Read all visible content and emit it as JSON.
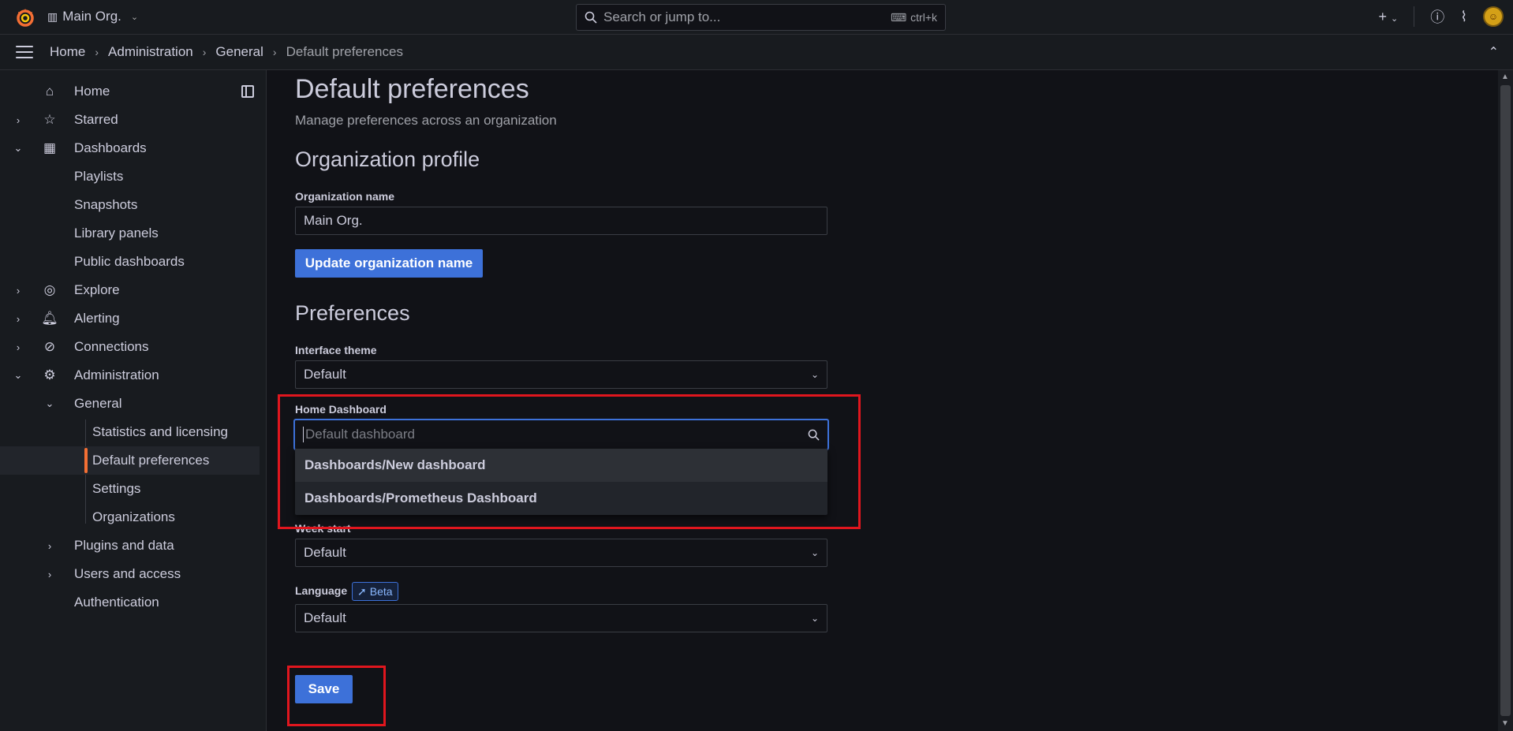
{
  "topbar": {
    "org_name": "Main Org.",
    "search_placeholder": "Search or jump to...",
    "search_shortcut": "ctrl+k"
  },
  "breadcrumbs": [
    "Home",
    "Administration",
    "General",
    "Default preferences"
  ],
  "sidebar": {
    "items": [
      {
        "label": "Home"
      },
      {
        "label": "Starred"
      },
      {
        "label": "Dashboards"
      },
      {
        "label": "Playlists"
      },
      {
        "label": "Snapshots"
      },
      {
        "label": "Library panels"
      },
      {
        "label": "Public dashboards"
      },
      {
        "label": "Explore"
      },
      {
        "label": "Alerting"
      },
      {
        "label": "Connections"
      },
      {
        "label": "Administration"
      },
      {
        "label": "General"
      },
      {
        "label": "Statistics and licensing"
      },
      {
        "label": "Default preferences"
      },
      {
        "label": "Settings"
      },
      {
        "label": "Organizations"
      },
      {
        "label": "Plugins and data"
      },
      {
        "label": "Users and access"
      },
      {
        "label": "Authentication"
      }
    ]
  },
  "page": {
    "title": "Default preferences",
    "subtitle": "Manage preferences across an organization"
  },
  "org_profile": {
    "heading": "Organization profile",
    "name_label": "Organization name",
    "name_value": "Main Org.",
    "update_button": "Update organization name"
  },
  "preferences": {
    "heading": "Preferences",
    "theme_label": "Interface theme",
    "theme_value": "Default",
    "home_dashboard_label": "Home Dashboard",
    "home_dashboard_placeholder": "Default dashboard",
    "home_dashboard_options": [
      "Dashboards/New dashboard",
      "Dashboards/Prometheus Dashboard"
    ],
    "week_start_label": "Week start",
    "week_start_value": "Default",
    "language_label": "Language",
    "language_badge": "Beta",
    "language_value": "Default",
    "save_button": "Save"
  },
  "colors": {
    "primary": "#3d71d9",
    "accent_active": "#f46f34",
    "highlight_box": "#e0161e",
    "background": "#111217"
  }
}
